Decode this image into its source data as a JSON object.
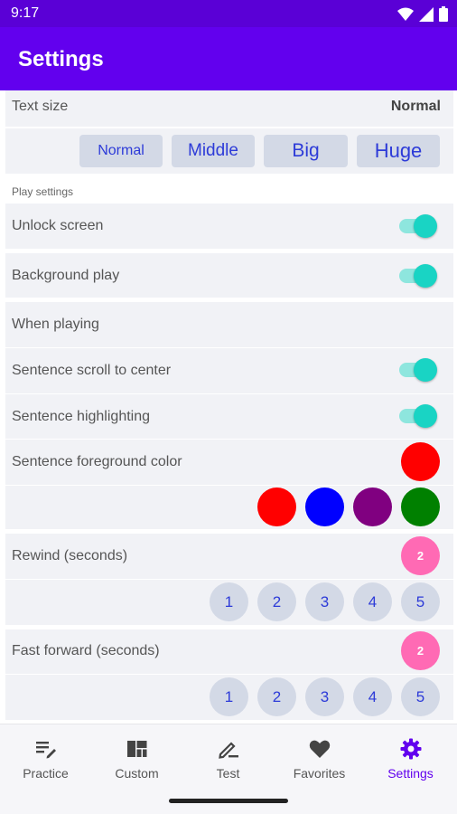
{
  "status_bar": {
    "time": "9:17",
    "icons": [
      "wifi-icon",
      "signal-icon",
      "battery-icon"
    ]
  },
  "app_bar": {
    "title": "Settings"
  },
  "text_size": {
    "label": "Text size",
    "value": "Normal",
    "options": [
      "Normal",
      "Middle",
      "Big",
      "Huge"
    ]
  },
  "play_settings": {
    "section_label": "Play settings",
    "unlock_screen": {
      "label": "Unlock screen",
      "enabled": true
    },
    "background_play": {
      "label": "Background play",
      "enabled": true
    }
  },
  "when_playing": {
    "label": "When playing",
    "scroll_to_center": {
      "label": "Sentence scroll to center",
      "enabled": true
    },
    "highlighting": {
      "label": "Sentence highlighting",
      "enabled": true
    },
    "foreground_color": {
      "label": "Sentence foreground color",
      "selected": "#ff0000",
      "options": [
        "#ff0000",
        "#0000ff",
        "#800080",
        "#008000"
      ]
    }
  },
  "rewind": {
    "label": "Rewind (seconds)",
    "selected": "2",
    "options": [
      "1",
      "2",
      "3",
      "4",
      "5"
    ]
  },
  "fast_forward": {
    "label": "Fast forward (seconds)",
    "selected": "2",
    "options": [
      "1",
      "2",
      "3",
      "4",
      "5"
    ]
  },
  "bottom_nav": {
    "active_color": "#6200ee",
    "items": [
      {
        "label": "Practice",
        "icon": "practice-icon"
      },
      {
        "label": "Custom",
        "icon": "custom-grid-icon"
      },
      {
        "label": "Test",
        "icon": "test-pen-icon"
      },
      {
        "label": "Favorites",
        "icon": "heart-icon"
      },
      {
        "label": "Settings",
        "icon": "gear-icon"
      }
    ]
  }
}
